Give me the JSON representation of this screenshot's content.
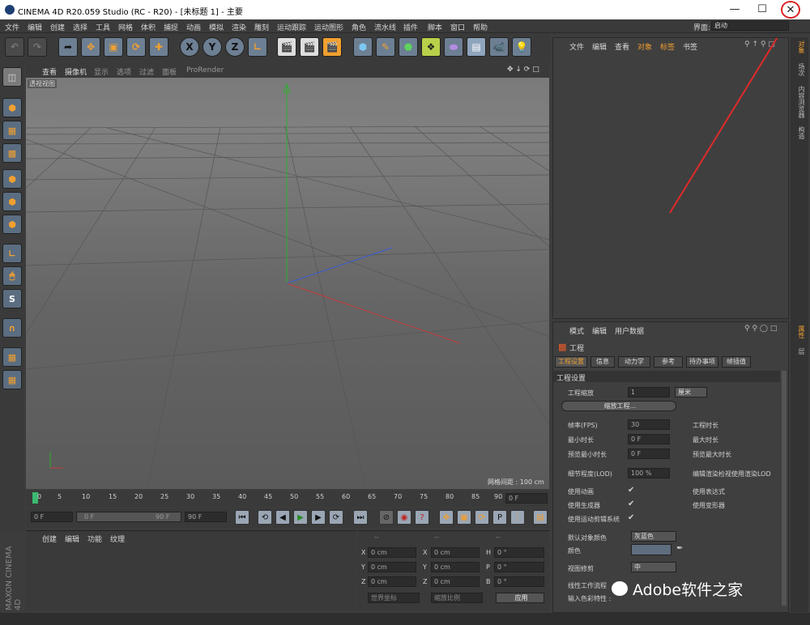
{
  "window": {
    "title": "CINEMA 4D R20.059 Studio (RC - R20) - [未标题 1] - 主要"
  },
  "menubar": {
    "items": [
      "文件",
      "编辑",
      "创建",
      "选择",
      "工具",
      "网格",
      "体积",
      "捕捉",
      "动画",
      "模拟",
      "渲染",
      "雕刻",
      "运动跟踪",
      "运动图形",
      "角色",
      "流水线",
      "插件",
      "脚本",
      "窗口",
      "帮助"
    ],
    "layout_label": "界面:",
    "layout_value": "启动"
  },
  "viewport": {
    "menu": [
      "查看",
      "摄像机",
      "显示",
      "选项",
      "过滤",
      "面板",
      "ProRender"
    ],
    "label": "透视视图",
    "grid_spacing": "网格间距 : 100 cm"
  },
  "timeline": {
    "ticks": [
      "0",
      "5",
      "10",
      "15",
      "20",
      "25",
      "30",
      "35",
      "40",
      "45",
      "50",
      "55",
      "60",
      "65",
      "70",
      "75",
      "80",
      "85",
      "90"
    ],
    "end_frame": "0 F"
  },
  "transport": {
    "current": "0 F",
    "min": "0 F",
    "range_end": "90 F",
    "max": "90 F"
  },
  "materials": {
    "menu": [
      "创建",
      "编辑",
      "功能",
      "纹理"
    ]
  },
  "coords": {
    "header": "--",
    "rows": [
      {
        "a": "X",
        "av": "0 cm",
        "b": "X",
        "bv": "0 cm",
        "c": "H",
        "cv": "0 °"
      },
      {
        "a": "Y",
        "av": "0 cm",
        "b": "Y",
        "bv": "0 cm",
        "c": "P",
        "cv": "0 °"
      },
      {
        "a": "Z",
        "av": "0 cm",
        "b": "Z",
        "bv": "0 cm",
        "c": "B",
        "cv": "0 °"
      }
    ],
    "world": "世界坐标",
    "scale": "缩放比例",
    "apply": "应用"
  },
  "objmgr": {
    "menu": [
      "文件",
      "编辑",
      "查看",
      "对象",
      "标签",
      "书签"
    ]
  },
  "attrmgr": {
    "menu": [
      "模式",
      "编辑",
      "用户数据"
    ],
    "title": "工程",
    "tabs": [
      "工程设置",
      "信息",
      "动力学",
      "参考",
      "待办事项",
      "帧插值"
    ],
    "section": "工程设置",
    "scale_label": "工程缩放",
    "scale_value": "1",
    "scale_unit": "厘米",
    "scale_button": "缩放工程...",
    "fps_label": "帧率(FPS)",
    "fps_value": "30",
    "doc_time": "工程时长",
    "min_time_label": "最小时长",
    "min_time_value": "0 F",
    "max_time": "最大时长",
    "prev_min_label": "预览最小时长",
    "prev_min_value": "0 F",
    "prev_max": "预览最大时长",
    "lod_label": "细节程度(LOD)",
    "lod_value": "100 %",
    "render_lod": "编辑渲染检视使用渲染LOD",
    "use_anim": "使用动画",
    "use_expr": "使用表达式",
    "use_gen": "使用生成器",
    "use_deform": "使用变形器",
    "use_motion": "使用运动剪辑系统",
    "def_color_label": "默认对象颜色",
    "def_color_value": "灰蓝色",
    "color_label": "颜色",
    "view_clip_label": "视图修剪",
    "view_clip_value": "中",
    "linear_workflow": "线性工作流程",
    "input_color": "输入色彩特性 :"
  },
  "right_tabs": [
    "对象",
    "场次",
    "内容浏览器",
    "构造"
  ],
  "right_tabs2": [
    "属性",
    "层"
  ],
  "watermark": "Adobe软件之家",
  "logo": "MAXON CINEMA 4D"
}
